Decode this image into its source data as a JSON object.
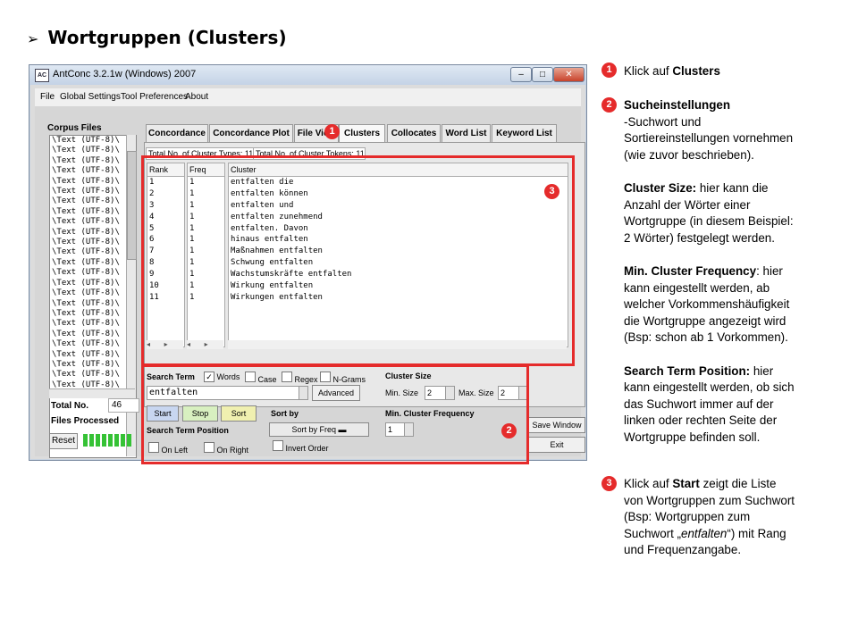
{
  "slide": {
    "heading": "Wortgruppen (Clusters)"
  },
  "window": {
    "title": "AntConc 3.2.1w (Windows) 2007",
    "icon_text": "AC",
    "controls": [
      "minimize-icon",
      "maximize-icon",
      "close-icon"
    ],
    "menu": [
      "File",
      "Global Settings",
      "Tool Preferences",
      "About"
    ]
  },
  "left_panel": {
    "corpus_files_label": "Corpus Files",
    "corpus_files": [
      "\\Text (UTF-8)\\",
      "\\Text (UTF-8)\\",
      "\\Text (UTF-8)\\",
      "\\Text (UTF-8)\\",
      "\\Text (UTF-8)\\",
      "\\Text (UTF-8)\\",
      "\\Text (UTF-8)\\",
      "\\Text (UTF-8)\\",
      "\\Text (UTF-8)\\",
      "\\Text (UTF-8)\\",
      "\\Text (UTF-8)\\",
      "\\Text (UTF-8)\\",
      "\\Text (UTF-8)\\",
      "\\Text (UTF-8)\\",
      "\\Text (UTF-8)\\",
      "\\Text (UTF-8)\\",
      "\\Text (UTF-8)\\",
      "\\Text (UTF-8)\\",
      "\\Text (UTF-8)\\",
      "\\Text (UTF-8)\\",
      "\\Text (UTF-8)\\",
      "\\Text (UTF-8)\\",
      "\\Text (UTF-8)\\",
      "\\Text (UTF-8)\\",
      "\\Text (UTF-8)\\"
    ],
    "total_no_label": "Total No.",
    "total_no_value": "46",
    "files_processed_label": "Files Processed",
    "reset_label": "Reset"
  },
  "tabs": [
    "Concordance",
    "Concordance Plot",
    "File View",
    "Clusters",
    "Collocates",
    "Word List",
    "Keyword List"
  ],
  "active_tab": "Clusters",
  "totals": {
    "types": "Total No. of Cluster Types: 11",
    "tokens": "Total No. of Cluster Tokens: 11"
  },
  "results": {
    "headers": {
      "rank": "Rank",
      "freq": "Freq",
      "cluster": "Cluster"
    },
    "rows": [
      {
        "rank": "1",
        "freq": "1",
        "cluster": "entfalten die"
      },
      {
        "rank": "2",
        "freq": "1",
        "cluster": "entfalten können"
      },
      {
        "rank": "3",
        "freq": "1",
        "cluster": "entfalten und"
      },
      {
        "rank": "4",
        "freq": "1",
        "cluster": "entfalten zunehmend"
      },
      {
        "rank": "5",
        "freq": "1",
        "cluster": "entfalten. Davon"
      },
      {
        "rank": "6",
        "freq": "1",
        "cluster": "hinaus entfalten"
      },
      {
        "rank": "7",
        "freq": "1",
        "cluster": "Maßnahmen entfalten"
      },
      {
        "rank": "8",
        "freq": "1",
        "cluster": "Schwung entfalten"
      },
      {
        "rank": "9",
        "freq": "1",
        "cluster": "Wachstumskräfte entfalten"
      },
      {
        "rank": "10",
        "freq": "1",
        "cluster": "Wirkung entfalten"
      },
      {
        "rank": "11",
        "freq": "1",
        "cluster": "Wirkungen entfalten"
      }
    ]
  },
  "search": {
    "search_term_label": "Search Term",
    "words_label": "Words",
    "words_checked": true,
    "case_label": "Case",
    "regex_label": "Regex",
    "ngrams_label": "N-Grams",
    "term_value": "entfalten",
    "advanced_label": "Advanced",
    "start_label": "Start",
    "stop_label": "Stop",
    "sort_label": "Sort",
    "position_label": "Search Term Position",
    "on_left_label": "On Left",
    "on_right_label": "On Right",
    "sort_by_label": "Sort by",
    "sort_by_value": "Sort by Freq",
    "invert_order_label": "Invert Order",
    "cluster_size_label": "Cluster Size",
    "min_size_label": "Min. Size",
    "min_size_value": "2",
    "max_size_label": "Max. Size",
    "max_size_value": "2",
    "min_freq_label": "Min. Cluster Frequency",
    "min_freq_value": "1",
    "save_window_label": "Save Window",
    "exit_label": "Exit"
  },
  "badges": {
    "one": "1",
    "two": "2",
    "three": "3"
  },
  "notes": {
    "n1_prefix": "Klick auf ",
    "n1_bold": "Clusters",
    "n2_title": "Sucheinstellungen",
    "n2_lines": [
      "-Suchwort und",
      "Sortiereinstellungen vornehmen",
      "(wie zuvor beschrieben)."
    ],
    "cluster_size_bold": "Cluster Size:",
    "cluster_size_lines": [
      " hier kann die",
      "Anzahl der Wörter einer",
      "Wortgruppe (in diesem Beispiel:",
      "2 Wörter) festgelegt werden."
    ],
    "min_freq_bold": "Min. Cluster Frequency",
    "min_freq_lines": [
      ": hier",
      "kann eingestellt werden, ab",
      "welcher Vorkommenshäufigkeit",
      "die Wortgruppe angezeigt wird",
      "(Bsp: schon ab 1 Vorkommen)."
    ],
    "position_bold": "Search Term Position:",
    "position_lines": [
      " hier",
      "kann eingestellt werden, ob sich",
      "das Suchwort immer auf der",
      "linken oder rechten Seite der",
      "Wortgruppe befinden soll."
    ],
    "n3_prefix": "Klick auf ",
    "n3_bold": "Start",
    "n3_lines": [
      " zeigt die Liste",
      "von Wortgruppen zum Suchwort",
      "(Bsp: Wortgruppen zum",
      "Suchwort „",
      "entfalten",
      "“) mit Rang",
      "und Frequenzangabe."
    ]
  }
}
